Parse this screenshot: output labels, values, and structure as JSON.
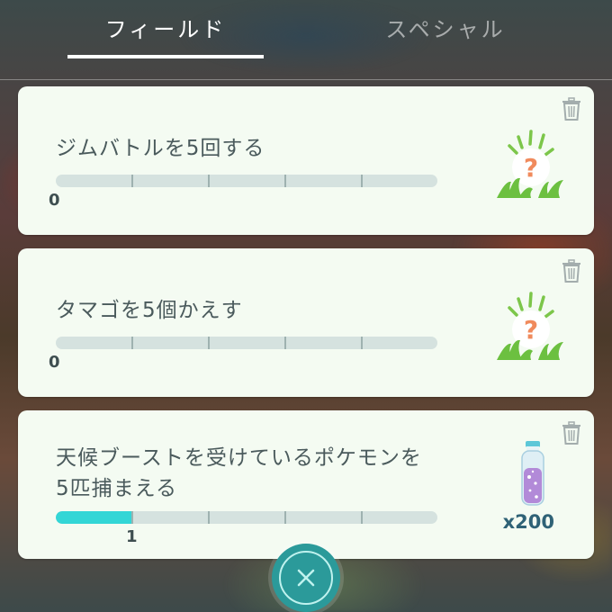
{
  "tabs": [
    {
      "label": "フィールド",
      "active": true
    },
    {
      "label": "スペシャル",
      "active": false
    }
  ],
  "quests": [
    {
      "title_lines": [
        "ジムバトルを5回する"
      ],
      "progress_label": "0",
      "progress_fraction": 0,
      "segments": 5,
      "reward_icon": "encounter-grass-question-icon",
      "reward_qty": ""
    },
    {
      "title_lines": [
        "タマゴを5個かえす"
      ],
      "progress_label": "0",
      "progress_fraction": 0,
      "segments": 5,
      "reward_icon": "encounter-grass-question-icon",
      "reward_qty": ""
    },
    {
      "title_lines": [
        "天候ブーストを受けているポケモンを",
        "5匹捕まえる"
      ],
      "progress_label": "1",
      "progress_fraction": 0.2,
      "segments": 5,
      "reward_icon": "stardust-icon",
      "reward_qty": "x200"
    }
  ],
  "colors": {
    "accent": "#33d6d6",
    "card_bg": "#f4fbf2",
    "text": "#4a5a5c",
    "close_button": "#2b9a9a"
  },
  "icons": {
    "delete": "trash-icon",
    "close": "close-icon"
  }
}
